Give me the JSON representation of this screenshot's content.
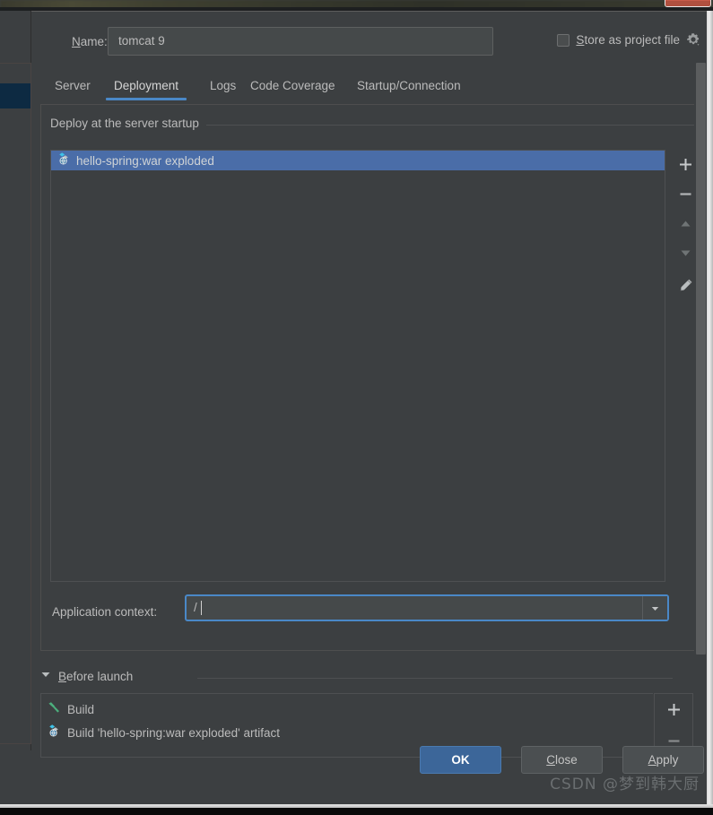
{
  "window": {
    "close_icon": "window-close-icon"
  },
  "header": {
    "name_label": "Name:",
    "name_label_mnemonic": "N",
    "name_value": "tomcat 9",
    "store_checkbox_label": "Store as project file",
    "store_checkbox_mnemonic": "S",
    "store_checkbox_checked": false,
    "gear_icon": "gear-icon"
  },
  "tabs": [
    {
      "label": "Server",
      "active": false
    },
    {
      "label": "Deployment",
      "active": true
    },
    {
      "label": "Logs",
      "active": false
    },
    {
      "label": "Code Coverage",
      "active": false
    },
    {
      "label": "Startup/Connection",
      "active": false
    }
  ],
  "deployment": {
    "section_title": "Deploy at the server startup",
    "items": [
      {
        "label": "hello-spring:war exploded",
        "icon": "artifact-icon",
        "selected": true
      }
    ],
    "tools": [
      {
        "name": "add-button",
        "glyph": "+"
      },
      {
        "name": "remove-button",
        "glyph": "−"
      },
      {
        "name": "move-up-button",
        "glyph": "▲"
      },
      {
        "name": "move-down-button",
        "glyph": "▼"
      },
      {
        "name": "edit-button",
        "glyph": "✎"
      }
    ],
    "app_context_label": "Application context:",
    "app_context_value": "/",
    "app_context_dropdown_icon": "chevron-down-icon"
  },
  "before_launch": {
    "title": "Before launch",
    "title_mnemonic": "B",
    "expanded": true,
    "collapse_icon": "triangle-down-icon",
    "items": [
      {
        "label": "Build",
        "icon": "build-hammer-icon"
      },
      {
        "label": "Build 'hello-spring:war exploded' artifact",
        "icon": "artifact-icon"
      }
    ],
    "tools": [
      {
        "name": "add-before-launch-button",
        "glyph": "+"
      },
      {
        "name": "remove-before-launch-button",
        "glyph": "−"
      }
    ]
  },
  "footer": {
    "ok_label": "OK",
    "close_label": "Close",
    "close_mnemonic": "C",
    "apply_label": "Apply",
    "apply_mnemonic": "A"
  },
  "watermark": "CSDN @梦到韩大厨",
  "colors": {
    "accent": "#4a88c7",
    "selection": "#4a6da8",
    "panel_bg": "#3c3f41",
    "field_bg": "#45494a",
    "primary_button": "#3c6699",
    "text": "#bbbbbb"
  }
}
